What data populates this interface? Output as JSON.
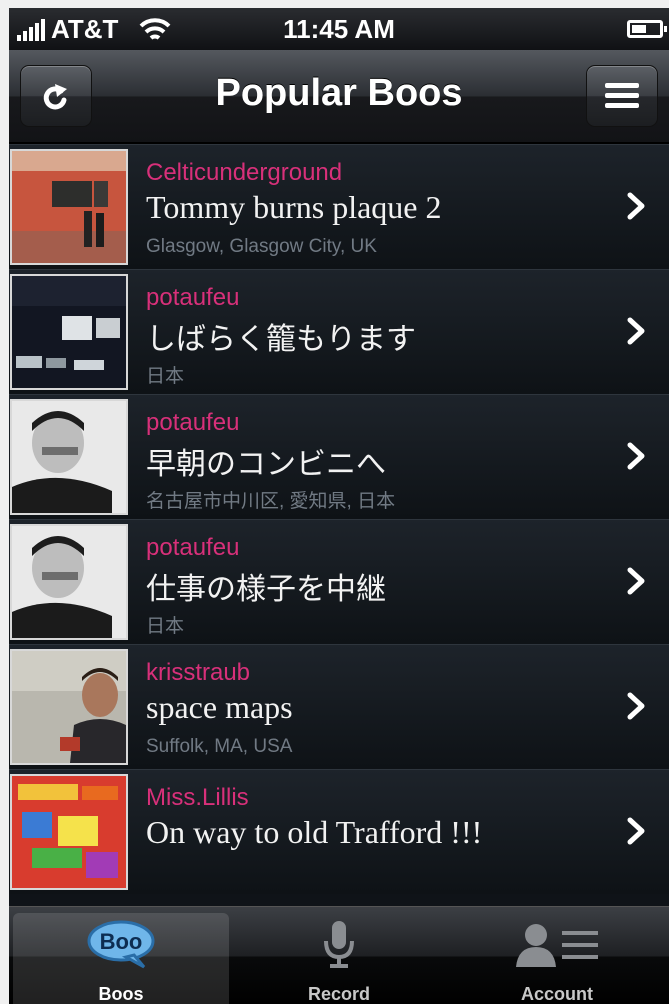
{
  "status_bar": {
    "carrier": "AT&T",
    "time": "11:45 AM"
  },
  "nav": {
    "title": "Popular Boos",
    "refresh_icon": "refresh-icon",
    "menu_icon": "list-icon"
  },
  "items": [
    {
      "user": "Celticunderground",
      "title": "Tommy burns plaque 2",
      "location": "Glasgow, Glasgow City, UK"
    },
    {
      "user": "potaufeu",
      "title": "しばらく籠もります",
      "location": "日本"
    },
    {
      "user": "potaufeu",
      "title": "早朝のコンビニへ",
      "location": "名古屋市中川区, 愛知県, 日本"
    },
    {
      "user": "potaufeu",
      "title": "仕事の様子を中継",
      "location": "日本"
    },
    {
      "user": "krisstraub",
      "title": "space maps",
      "location": "Suffolk, MA, USA"
    },
    {
      "user": "Miss.Lillis",
      "title": "On way to old Trafford !!!",
      "location": ""
    }
  ],
  "tabs": [
    {
      "label": "Boos",
      "icon": "boo-speech-bubble-icon",
      "logo_text": "Boo",
      "active": true
    },
    {
      "label": "Record",
      "icon": "microphone-icon",
      "active": false
    },
    {
      "label": "Account",
      "icon": "account-list-icon",
      "active": false
    }
  ],
  "colors": {
    "username": "#d8307a",
    "title": "#f2f2f2",
    "location": "#717a84",
    "background": "#0f1318"
  }
}
